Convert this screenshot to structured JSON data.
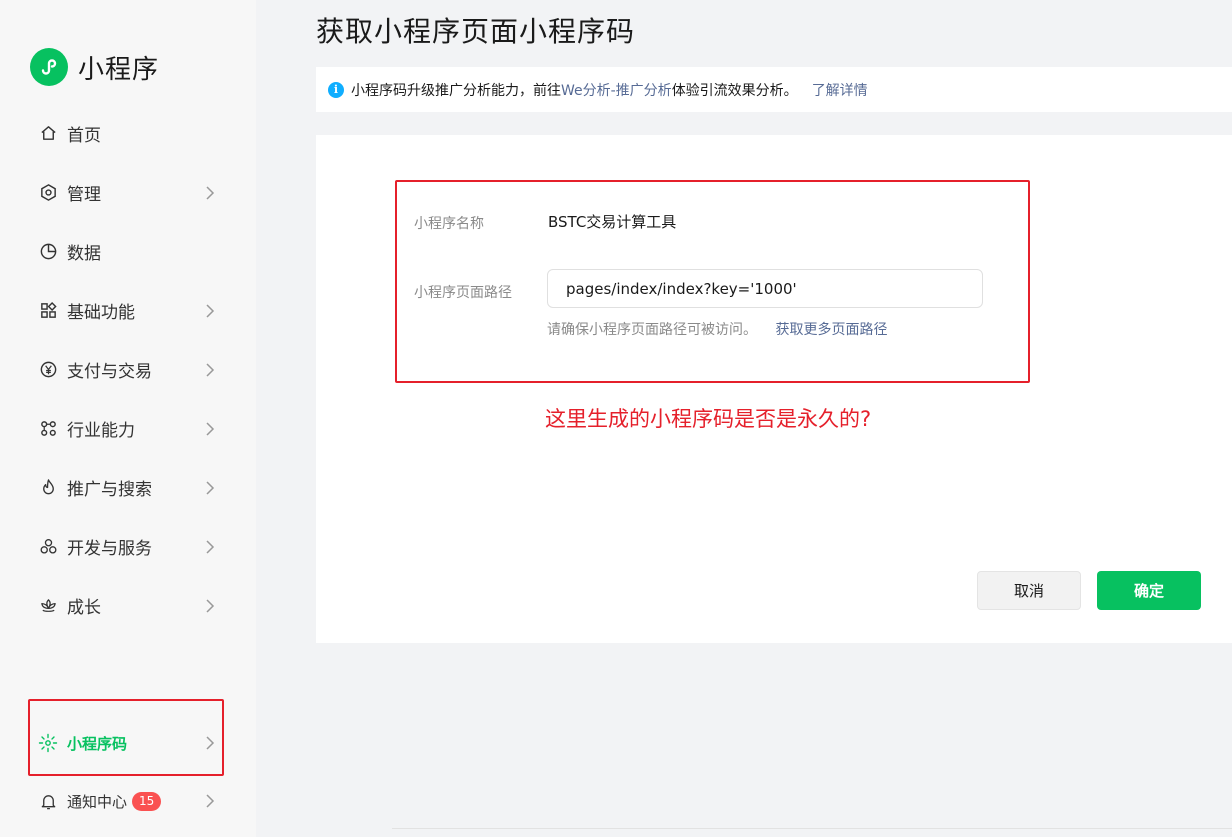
{
  "app": {
    "name": "小程序"
  },
  "sidebar": {
    "items": [
      {
        "label": "首页",
        "icon": "home-icon",
        "has_arrow": false
      },
      {
        "label": "管理",
        "icon": "hexagon-settings-icon",
        "has_arrow": true
      },
      {
        "label": "数据",
        "icon": "pie-chart-icon",
        "has_arrow": false
      },
      {
        "label": "基础功能",
        "icon": "grid-apps-icon",
        "has_arrow": true
      },
      {
        "label": "支付与交易",
        "icon": "yuan-icon",
        "has_arrow": true
      },
      {
        "label": "行业能力",
        "icon": "industry-nodes-icon",
        "has_arrow": true
      },
      {
        "label": "推广与搜索",
        "icon": "flame-icon",
        "has_arrow": true
      },
      {
        "label": "开发与服务",
        "icon": "dev-circles-icon",
        "has_arrow": true
      },
      {
        "label": "成长",
        "icon": "lotus-icon",
        "has_arrow": true
      }
    ],
    "bottom": [
      {
        "label": "小程序码",
        "icon": "mini-program-code-icon",
        "active": true
      },
      {
        "label": "通知中心",
        "icon": "bell-icon",
        "badge": "15"
      }
    ]
  },
  "page": {
    "title": "获取小程序页面小程序码",
    "notice": {
      "text_before": "小程序码升级推广分析能力，前往",
      "link_text": "We分析-推广分析",
      "text_after": "体验引流效果分析。",
      "detail_link": "了解详情"
    },
    "form": {
      "name_label": "小程序名称",
      "name_value": "BSTC交易计算工具",
      "path_label": "小程序页面路径",
      "path_value": "pages/index/index?key='1000'",
      "hint_text": "请确保小程序页面路径可被访问。",
      "hint_link": "获取更多页面路径"
    },
    "annotation": "这里生成的小程序码是否是永久的?",
    "buttons": {
      "cancel": "取消",
      "confirm": "确定"
    }
  },
  "colors": {
    "brand": "#07c160",
    "link": "#576b95",
    "annotation_red": "#e5202b",
    "info_blue": "#10aeff",
    "badge_red": "#fa5151"
  }
}
